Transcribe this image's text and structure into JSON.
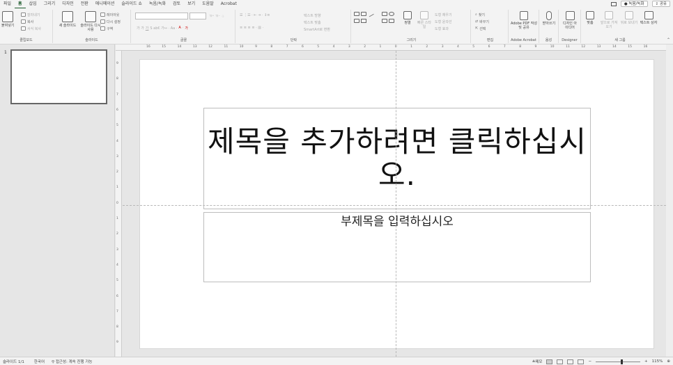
{
  "menu": {
    "tabs": [
      "파일",
      "홈",
      "삽입",
      "그리기",
      "디자인",
      "전환",
      "애니메이션",
      "슬라이드 쇼",
      "녹음/녹화",
      "검토",
      "보기",
      "도움말",
      "Acrobat"
    ],
    "active_tab": "홈",
    "record_button": "녹음/녹화",
    "share_button": "공유"
  },
  "ribbon": {
    "clipboard": {
      "name": "클립보드",
      "paste": "붙여넣기",
      "cut": "잘라내기",
      "copy": "복사",
      "format_painter": "서식 복사"
    },
    "slides": {
      "name": "슬라이드",
      "new_slide": "새 슬라이드",
      "reuse": "슬라이드 다시 사용",
      "layout": "레이아웃",
      "reset": "다시 설정",
      "section": "구역"
    },
    "font": {
      "name": "글꼴"
    },
    "paragraph": {
      "name": "단락",
      "text_direction": "텍스트 방향",
      "align_text": "텍스트 맞춤",
      "smartart": "SmartArt로 변환"
    },
    "drawing": {
      "name": "그리기",
      "arrange": "정렬",
      "quick_styles": "빠른 스타일",
      "fill": "도형 채우기",
      "outline": "도형 윤곽선",
      "effects": "도형 효과"
    },
    "editing": {
      "name": "편집",
      "find": "찾기",
      "replace": "바꾸기",
      "select": "선택"
    },
    "acrobat": {
      "name": "Adobe Acrobat",
      "create": "Adobe PDF 작성 및 공유"
    },
    "voice": {
      "name": "음성",
      "dictate": "받아쓰기"
    },
    "designer": {
      "name": "Designer",
      "ideas": "디자인 아이디어"
    },
    "new_group": {
      "name": "새 그룹",
      "align": "맞춤",
      "bring_front": "앞으로 가져오기",
      "send_back": "뒤로 보내기",
      "textbox": "텍스트 상자"
    }
  },
  "ruler": {
    "h_ticks": [
      "16",
      "15",
      "14",
      "13",
      "12",
      "11",
      "10",
      "9",
      "8",
      "7",
      "6",
      "5",
      "4",
      "3",
      "2",
      "1",
      "0",
      "1",
      "2",
      "3",
      "4",
      "5",
      "6",
      "7",
      "8",
      "9",
      "10",
      "11",
      "12",
      "13",
      "14",
      "15",
      "16"
    ],
    "v_ticks": [
      "9",
      "8",
      "7",
      "6",
      "5",
      "4",
      "3",
      "2",
      "1",
      "0",
      "1",
      "2",
      "3",
      "4",
      "5",
      "6",
      "7",
      "8",
      "9"
    ]
  },
  "thumbnails": {
    "slide_number": "1"
  },
  "slide": {
    "title_placeholder": "제목을 추가하려면 클릭하십시오.",
    "subtitle_placeholder": "부제목을 입력하십시오"
  },
  "status": {
    "slide_counter": "슬라이드 1/1",
    "language": "한국어",
    "accessibility": "접근성: 계속 진행 가능",
    "notes": "메모",
    "zoom": "115%"
  }
}
